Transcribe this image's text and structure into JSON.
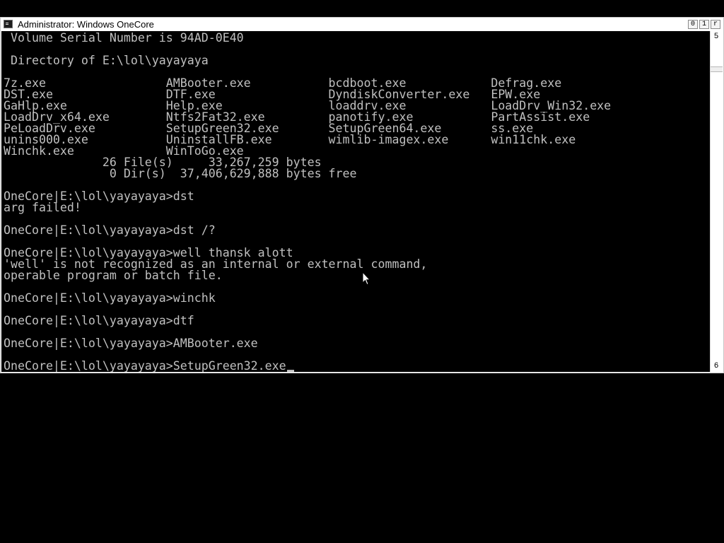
{
  "window": {
    "title": "Administrator:  Windows OneCore",
    "buttons": {
      "minimize": "0",
      "maximize": "1",
      "close": "r"
    }
  },
  "scrollbar": {
    "up_glyph": "5",
    "down_glyph": "6"
  },
  "console": {
    "lines": [
      " Volume Serial Number is 94AD-0E40",
      "",
      " Directory of E:\\lol\\yayayaya",
      "",
      "7z.exe                 AMBooter.exe           bcdboot.exe            Defrag.exe",
      "DST.exe                DTF.exe                DyndiskConverter.exe   EPW.exe",
      "GaHlp.exe              Help.exe               loaddrv.exe            LoadDrv_Win32.exe",
      "LoadDrv_x64.exe        Ntfs2Fat32.exe         panotify.exe           PartAssist.exe",
      "PeLoadDrv.exe          SetupGreen32.exe       SetupGreen64.exe       ss.exe",
      "unins000.exe           UninstallFB.exe        wimlib-imagex.exe      win11chk.exe",
      "Winchk.exe             WinToGo.exe",
      "              26 File(s)     33,267,259 bytes",
      "               0 Dir(s)  37,406,629,888 bytes free",
      "",
      "OneCore|E:\\lol\\yayayaya>dst",
      "arg failed!",
      "",
      "OneCore|E:\\lol\\yayayaya>dst /?",
      "",
      "OneCore|E:\\lol\\yayayaya>well thansk alott",
      "'well' is not recognized as an internal or external command,",
      "operable program or batch file.",
      "",
      "OneCore|E:\\lol\\yayayaya>winchk",
      "",
      "OneCore|E:\\lol\\yayayaya>dtf",
      "",
      "OneCore|E:\\lol\\yayayaya>AMBooter.exe",
      ""
    ],
    "prompt_line": "OneCore|E:\\lol\\yayayaya>SetupGreen32.exe"
  },
  "colors": {
    "console_bg": "#000000",
    "console_text": "#c0c0c0",
    "chrome": "#ffffff"
  }
}
